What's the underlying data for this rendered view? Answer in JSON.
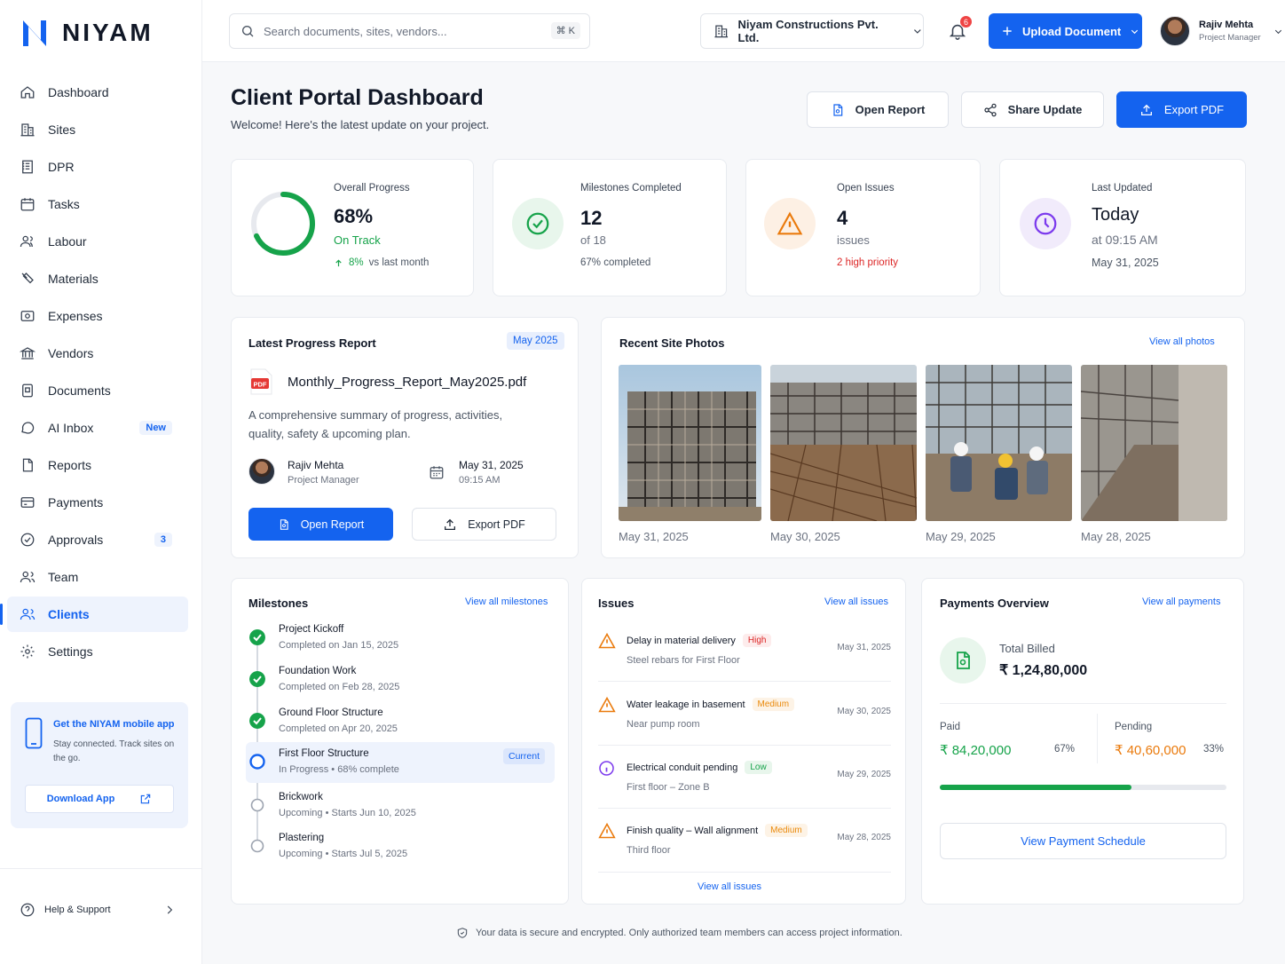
{
  "brand": {
    "name": "NIYAM",
    "color": "#1463EF"
  },
  "sidebar": {
    "items": [
      {
        "label": "Dashboard",
        "icon": "home-icon"
      },
      {
        "label": "Sites",
        "icon": "building-icon"
      },
      {
        "label": "DPR",
        "icon": "dpr-icon"
      },
      {
        "label": "Tasks",
        "icon": "calendar-check-icon"
      },
      {
        "label": "Labour",
        "icon": "labour-icon"
      },
      {
        "label": "Materials",
        "icon": "materials-icon"
      },
      {
        "label": "Expenses",
        "icon": "expenses-icon"
      },
      {
        "label": "Vendors",
        "icon": "vendor-icon"
      },
      {
        "label": "Documents",
        "icon": "document-icon"
      },
      {
        "label": "AI Inbox",
        "icon": "chat-icon",
        "badge": "New"
      },
      {
        "label": "Reports",
        "icon": "report-icon"
      },
      {
        "label": "Payments",
        "icon": "payment-icon"
      },
      {
        "label": "Approvals",
        "icon": "approval-icon",
        "badge": "3"
      },
      {
        "label": "Team",
        "icon": "team-icon"
      },
      {
        "label": "Clients",
        "icon": "clients-icon",
        "active": true
      },
      {
        "label": "Settings",
        "icon": "gear-icon"
      }
    ],
    "promo": {
      "title": "Get the NIYAM mobile app",
      "text": "Stay connected. Track sites on the go.",
      "button": "Download App"
    },
    "help": "Help & Support"
  },
  "topbar": {
    "search_placeholder": "Search documents, sites, vendors...",
    "search_shortcut": "⌘ K",
    "company": "Niyam Constructions Pvt. Ltd.",
    "notifications": "6",
    "upload": "Upload Document",
    "user": {
      "name": "Rajiv Mehta",
      "role": "Project Manager"
    }
  },
  "header": {
    "title": "Client Portal Dashboard",
    "subtitle": "Welcome! Here's the latest update on your project.",
    "open_report": "Open Report",
    "share_update": "Share Update",
    "export_pdf": "Export PDF"
  },
  "stats": {
    "progress": {
      "label": "Overall Progress",
      "value": "68%",
      "status": "On Track",
      "delta": "8%",
      "delta_text": "vs last month",
      "fraction": 0.68
    },
    "milestones": {
      "label": "Milestones Completed",
      "value": "12",
      "sub": "of 18",
      "foot": "67% completed"
    },
    "issues": {
      "label": "Open Issues",
      "value": "4",
      "sub": "issues",
      "foot": "2 high priority"
    },
    "updated": {
      "label": "Last Updated",
      "value": "Today",
      "sub": "at 09:15 AM",
      "foot": "May 31, 2025"
    }
  },
  "report": {
    "title": "Latest Progress Report",
    "badge": "May 2025",
    "file": "Monthly_Progress_Report_May2025.pdf",
    "description": "A comprehensive summary of progress, activities, quality, safety & upcoming plan.",
    "author": "Rajiv Mehta",
    "author_role": "Project Manager",
    "date": "May 31, 2025",
    "time": "09:15 AM",
    "open": "Open Report",
    "export": "Export PDF"
  },
  "photos": {
    "title": "Recent Site Photos",
    "link": "View all photos",
    "items": [
      {
        "date": "May 31, 2025"
      },
      {
        "date": "May 30, 2025"
      },
      {
        "date": "May 29, 2025"
      },
      {
        "date": "May 28, 2025"
      }
    ]
  },
  "milestones": {
    "title": "Milestones",
    "link": "View all milestones",
    "items": [
      {
        "title": "Project Kickoff",
        "sub": "Completed on Jan 15, 2025",
        "state": "done"
      },
      {
        "title": "Foundation Work",
        "sub": "Completed on Feb 28, 2025",
        "state": "done"
      },
      {
        "title": "Ground Floor Structure",
        "sub": "Completed on Apr 20, 2025",
        "state": "done"
      },
      {
        "title": "First Floor Structure",
        "sub": "In Progress  •  68% complete",
        "state": "current",
        "badge": "Current"
      },
      {
        "title": "Brickwork",
        "sub": "Upcoming  •  Starts Jun 10, 2025",
        "state": "upcoming"
      },
      {
        "title": "Plastering",
        "sub": "Upcoming  •  Starts Jul 5, 2025",
        "state": "upcoming"
      }
    ]
  },
  "issues": {
    "title": "Issues",
    "link": "View all issues",
    "footer_link": "View all issues",
    "items": [
      {
        "title": "Delay in material delivery",
        "priority": "High",
        "sub": "Steel rebars for First Floor",
        "date": "May 31, 2025"
      },
      {
        "title": "Water leakage in basement",
        "priority": "Medium",
        "sub": "Near pump room",
        "date": "May 30, 2025"
      },
      {
        "title": "Electrical conduit pending",
        "priority": "Low",
        "sub": "First floor – Zone B",
        "date": "May 29, 2025"
      },
      {
        "title": "Finish quality – Wall alignment",
        "priority": "Medium",
        "sub": "Third floor",
        "date": "May 28, 2025"
      }
    ]
  },
  "payments": {
    "title": "Payments Overview",
    "link": "View all payments",
    "billed_label": "Total Billed",
    "billed": "₹ 1,24,80,000",
    "paid_label": "Paid",
    "paid": "₹ 84,20,000",
    "paid_pct": "67%",
    "pending_label": "Pending",
    "pending": "₹ 40,60,000",
    "pending_pct": "33%",
    "paid_fraction": 0.67,
    "button": "View Payment Schedule"
  },
  "footer": "Your data is secure and encrypted. Only authorized team members can access project information."
}
